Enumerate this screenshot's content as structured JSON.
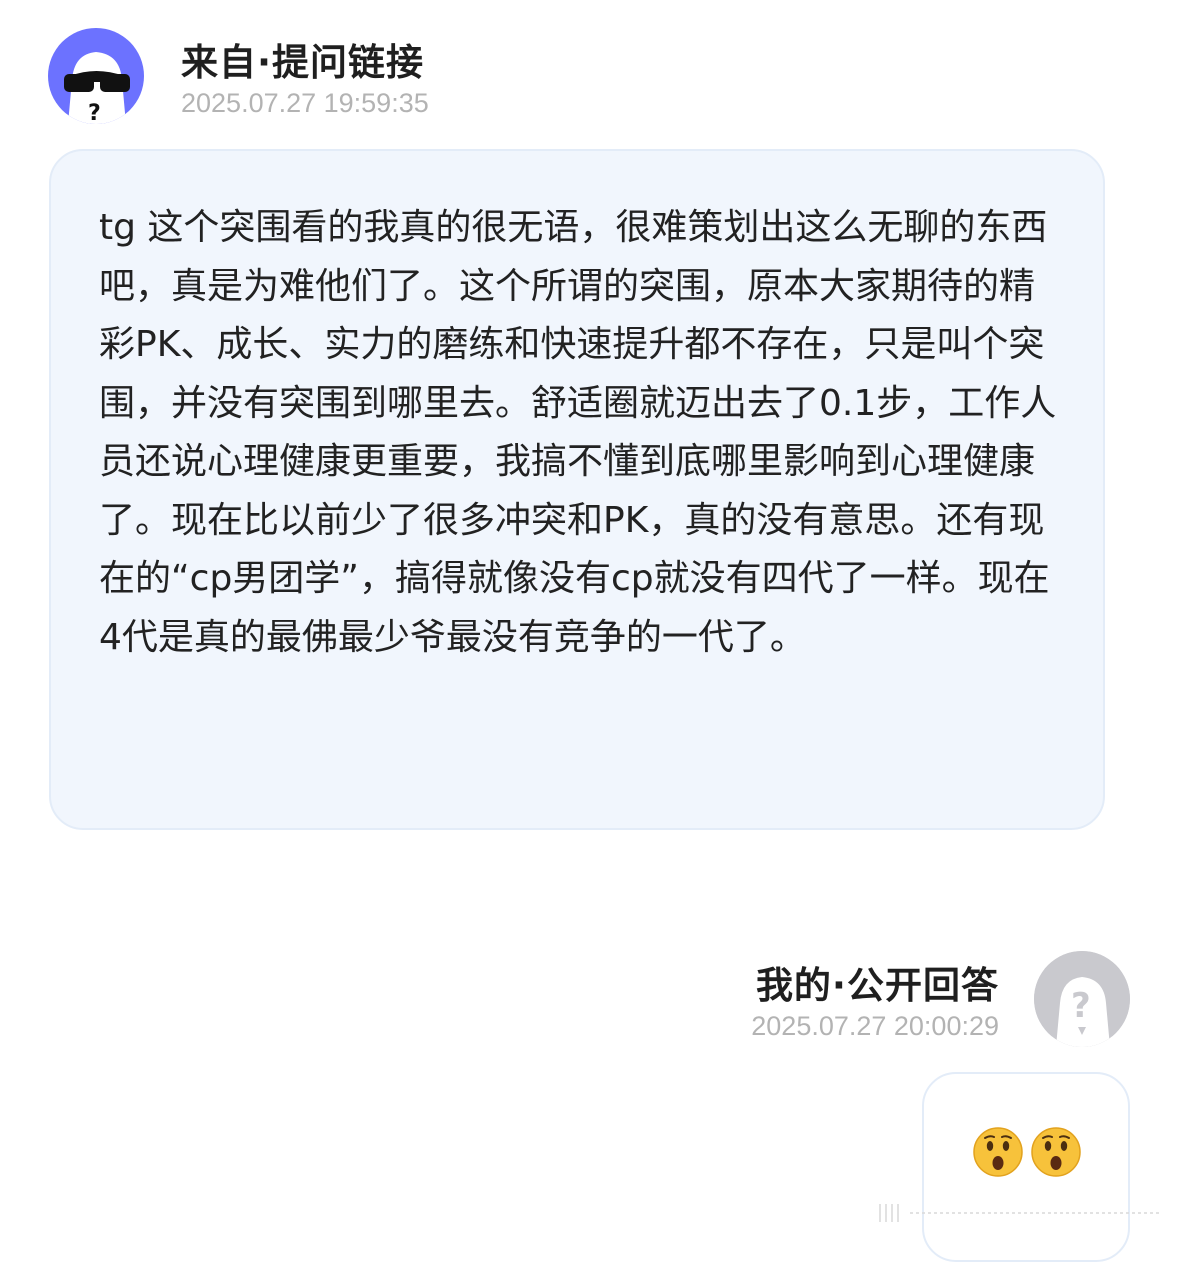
{
  "question": {
    "header_title": "来自·提问链接",
    "timestamp": "2025.07.27 19:59:35",
    "avatar_icon": "sunglasses-face-icon",
    "avatar_color": "#6c72ff",
    "body": "tg 这个突围看的我真的很无语，很难策划出这么无聊的东西吧，真是为难他们了。这个所谓的突围，原本大家期待的精彩PK、成长、实力的磨练和快速提升都不存在，只是叫个突围，并没有突围到哪里去。舒适圈就迈出去了0.1步，工作人员还说心理健康更重要，我搞不懂到底哪里影响到心理健康了。现在比以前少了很多冲突和PK，真的没有意思。还有现在的“cp男团学”，搞得就像没有cp就没有四代了一样。现在4代是真的最佛最少爷最没有竞争的一代了。"
  },
  "answer": {
    "header_title": "我的·公开回答",
    "timestamp": "2025.07.27 20:00:29",
    "avatar_icon": "anonymous-question-avatar-icon",
    "emojis": [
      "hushed-face-emoji",
      "hushed-face-emoji"
    ]
  },
  "colors": {
    "card_bg": "#f1f6fd",
    "card_border": "#e3ecf8",
    "timestamp": "#b3b3b3"
  }
}
